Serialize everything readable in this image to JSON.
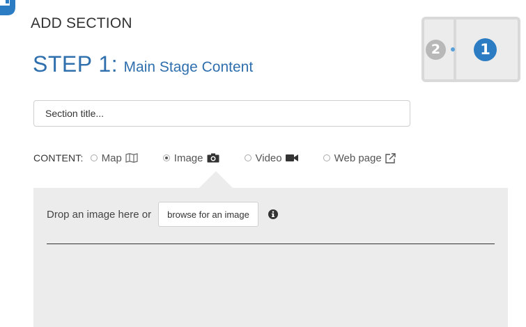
{
  "header": {
    "add_section": "ADD SECTION",
    "step_number": "STEP 1:",
    "step_subtitle": "Main Stage Content"
  },
  "layout_preview": {
    "secondary_number": "2",
    "primary_number": "1"
  },
  "section_title": {
    "placeholder": "Section title...",
    "value": ""
  },
  "content_type": {
    "label": "CONTENT:",
    "selected": "Image",
    "options": [
      {
        "label": "Map",
        "icon": "map-icon",
        "checked": false
      },
      {
        "label": "Image",
        "icon": "camera-icon",
        "checked": true
      },
      {
        "label": "Video",
        "icon": "video-camera-icon",
        "checked": false
      },
      {
        "label": "Web page",
        "icon": "external-link-icon",
        "checked": false
      }
    ]
  },
  "drop_zone": {
    "text": "Drop an image here or",
    "browse_label": "browse for an image",
    "info_icon": "info-icon"
  },
  "colors": {
    "accent": "#2f6fad",
    "primary_badge": "#2b7cc2",
    "secondary_badge": "#b8b8b8",
    "panel_bg": "#ececec"
  }
}
